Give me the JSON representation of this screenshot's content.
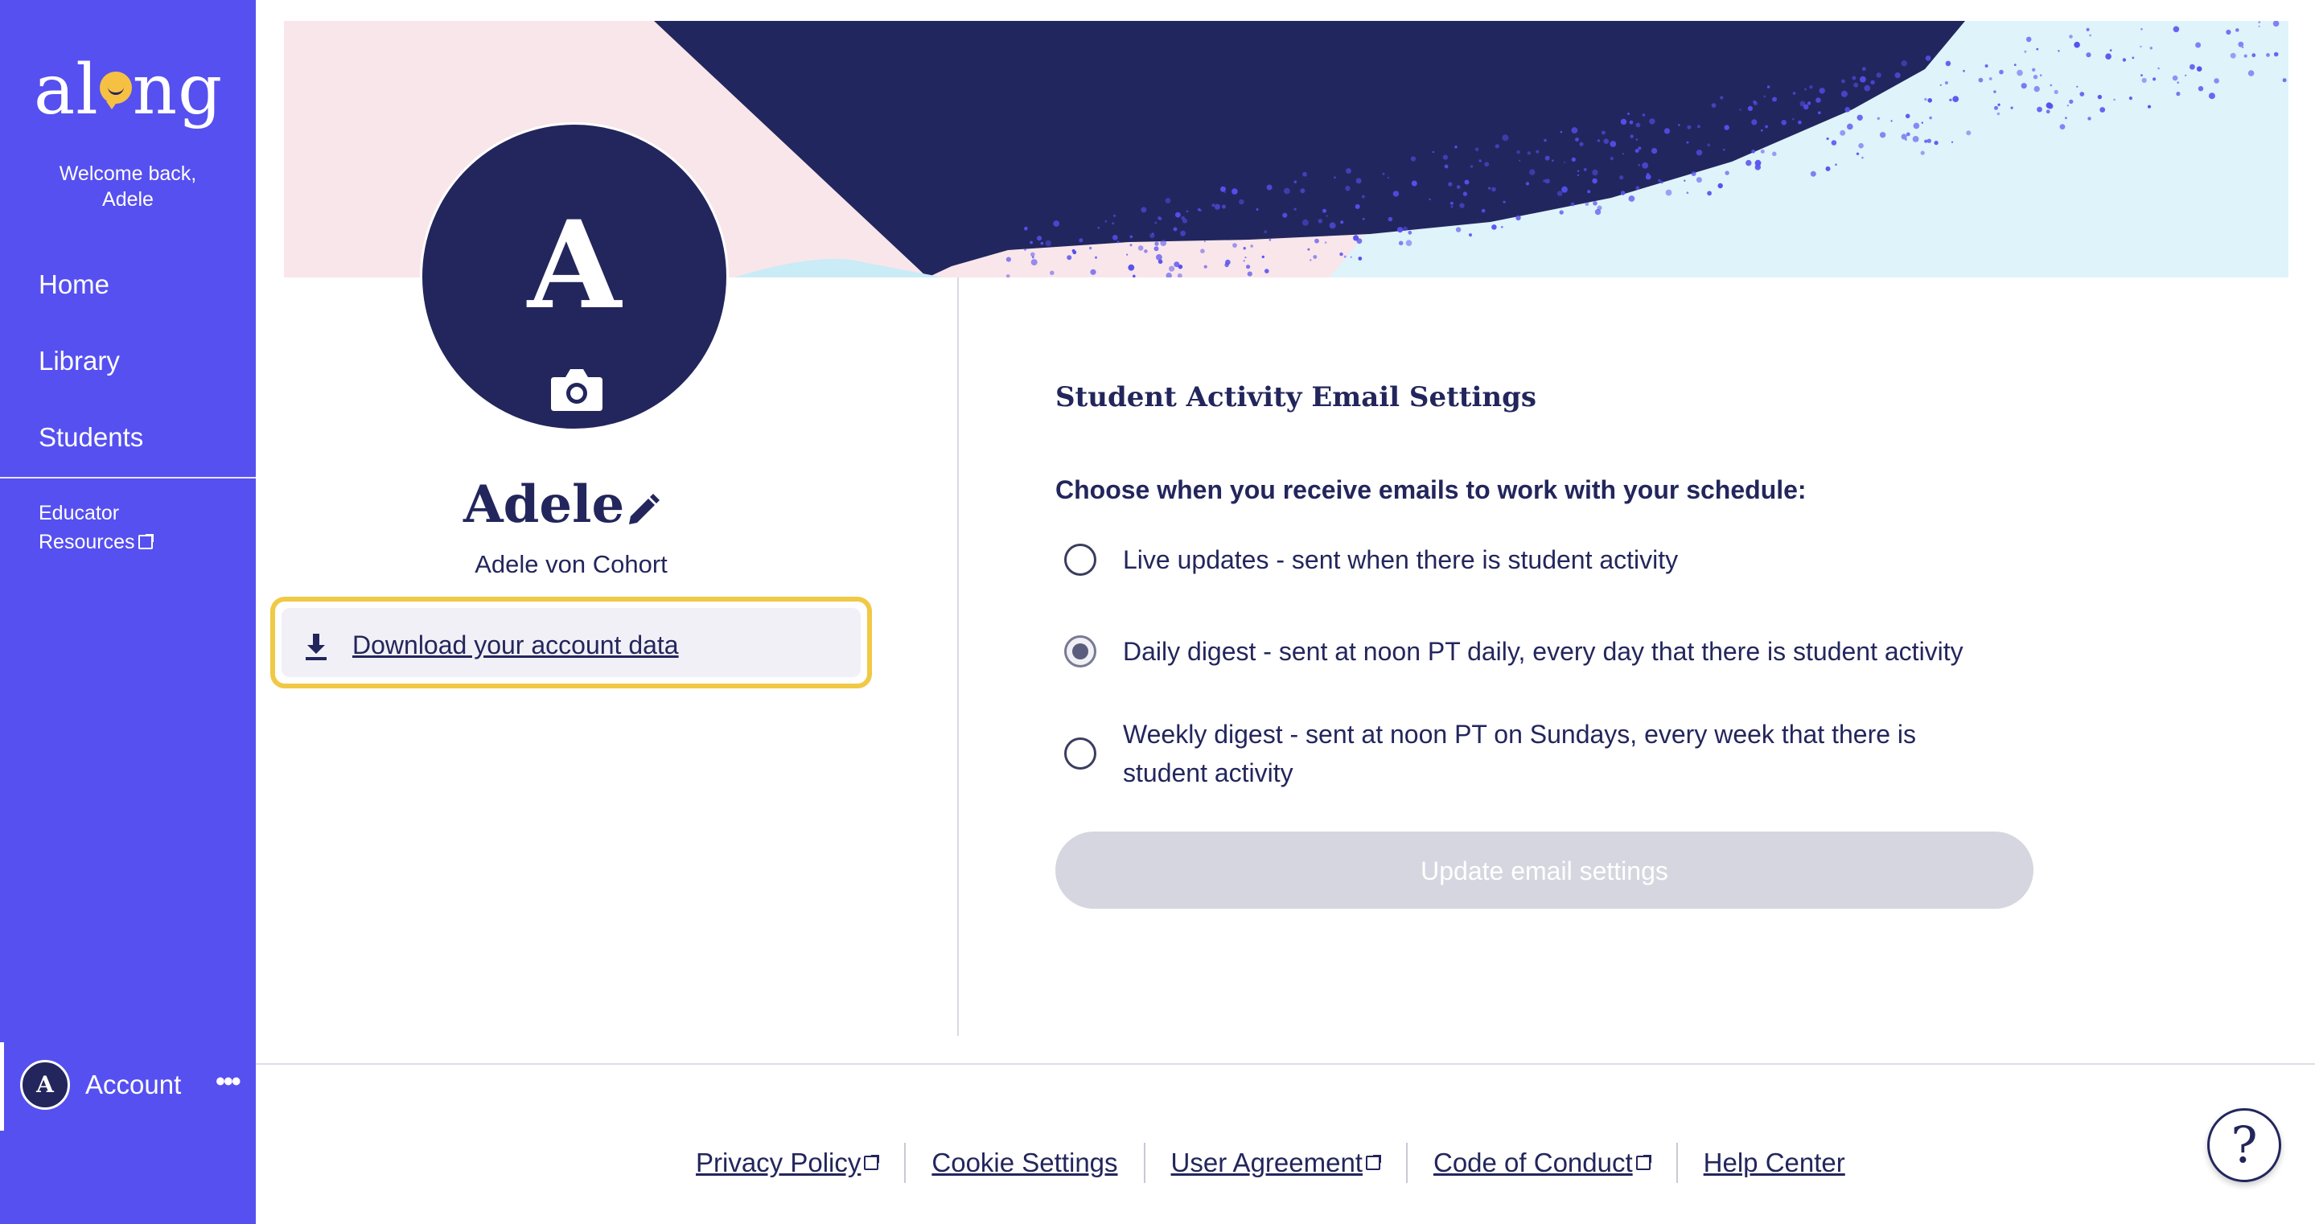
{
  "app": {
    "logo_text": "along"
  },
  "sidebar": {
    "welcome_line1": "Welcome back,",
    "welcome_line2": "Adele",
    "nav": [
      {
        "label": "Home"
      },
      {
        "label": "Library"
      },
      {
        "label": "Students"
      }
    ],
    "educator_line1": "Educator",
    "educator_line2": "Resources",
    "account": {
      "avatar_letter": "A",
      "label": "Account"
    }
  },
  "profile": {
    "avatar_letter": "A",
    "name": "Adele",
    "full_name": "Adele von Cohort",
    "download_label": "Download your account data"
  },
  "settings": {
    "title": "Student Activity Email Settings",
    "prompt": "Choose when you receive emails to work with your schedule:",
    "options": [
      {
        "label": "Live updates - sent when there is student activity",
        "selected": false
      },
      {
        "label": "Daily digest - sent at noon PT daily, every day that there is student activity",
        "selected": true
      },
      {
        "label": "Weekly digest - sent at noon PT on Sundays, every week that there is student activity",
        "selected": false
      }
    ],
    "update_button": "Update email settings"
  },
  "footer": {
    "links": [
      {
        "label": "Privacy Policy",
        "external": true
      },
      {
        "label": "Cookie Settings",
        "external": false
      },
      {
        "label": "User Agreement",
        "external": true
      },
      {
        "label": "Code of Conduct",
        "external": true
      },
      {
        "label": "Help Center",
        "external": false
      }
    ],
    "help_glyph": "?"
  },
  "colors": {
    "sidebar": "#5650f0",
    "navy": "#23265c",
    "highlight": "#f0c945",
    "button_disabled": "#d6d6e0"
  }
}
